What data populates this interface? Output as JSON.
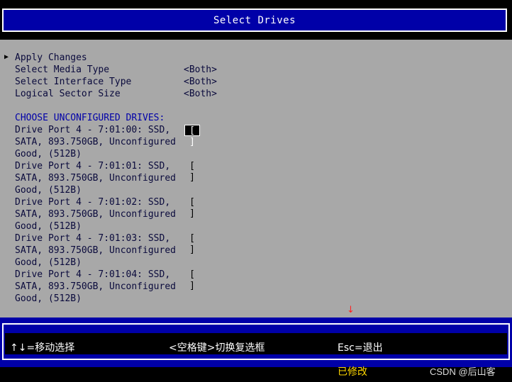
{
  "title": "Select Drives",
  "menu": {
    "apply_changes": "Apply Changes",
    "options": [
      {
        "label": "Select Media Type",
        "value": "<Both>"
      },
      {
        "label": "Select Interface Type",
        "value": "<Both>"
      },
      {
        "label": "Logical Sector Size",
        "value": "<Both>"
      }
    ]
  },
  "drives_header": "CHOOSE UNCONFIGURED DRIVES:",
  "drives": [
    {
      "line1": "Drive Port 4 - 7:01:00: SSD,",
      "line2": "SATA, 893.750GB, Unconfigured",
      "line3": "Good, (512B)",
      "checkbox": "[ ]",
      "selected": true
    },
    {
      "line1": "Drive Port 4 - 7:01:01: SSD,",
      "line2": "SATA, 893.750GB, Unconfigured",
      "line3": "Good, (512B)",
      "checkbox": "[ ]",
      "selected": false
    },
    {
      "line1": "Drive Port 4 - 7:01:02: SSD,",
      "line2": "SATA, 893.750GB, Unconfigured",
      "line3": "Good, (512B)",
      "checkbox": "[ ]",
      "selected": false
    },
    {
      "line1": "Drive Port 4 - 7:01:03: SSD,",
      "line2": "SATA, 893.750GB, Unconfigured",
      "line3": "Good, (512B)",
      "checkbox": "[ ]",
      "selected": false
    },
    {
      "line1": "Drive Port 4 - 7:01:04: SSD,",
      "line2": "SATA, 893.750GB, Unconfigured",
      "line3": "Good, (512B)",
      "checkbox": "[ ]",
      "selected": false
    }
  ],
  "footer": {
    "move": "↑↓=移动选择",
    "toggle": "<空格键>切换复选框",
    "esc": "Esc=退出"
  },
  "annotation": {
    "arrow": "↓",
    "modified": "已修改"
  },
  "watermark": "CSDN @后山客"
}
